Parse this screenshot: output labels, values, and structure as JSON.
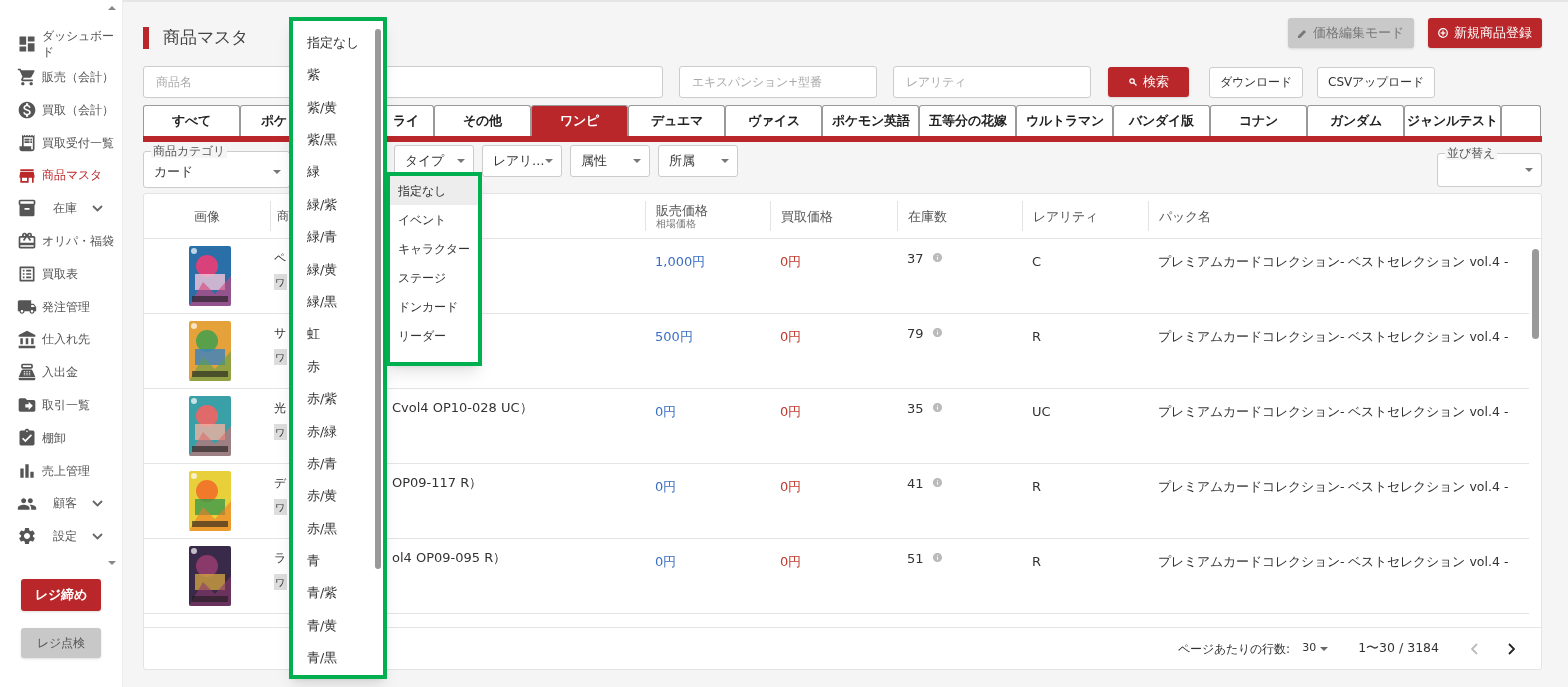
{
  "sidebar": {
    "items": [
      {
        "label": "ダッシュボード",
        "selected": false,
        "expandable": false
      },
      {
        "label": "販売（会計）",
        "selected": false,
        "expandable": false
      },
      {
        "label": "買取（会計）",
        "selected": false,
        "expandable": false
      },
      {
        "label": "買取受付一覧",
        "selected": false,
        "expandable": false
      },
      {
        "label": "商品マスタ",
        "selected": true,
        "expandable": false
      },
      {
        "label": "在庫",
        "selected": false,
        "expandable": true
      },
      {
        "label": "オリパ・福袋",
        "selected": false,
        "expandable": false
      },
      {
        "label": "買取表",
        "selected": false,
        "expandable": false
      },
      {
        "label": "発注管理",
        "selected": false,
        "expandable": false
      },
      {
        "label": "仕入れ先",
        "selected": false,
        "expandable": false
      },
      {
        "label": "入出金",
        "selected": false,
        "expandable": false
      },
      {
        "label": "取引一覧",
        "selected": false,
        "expandable": false
      },
      {
        "label": "棚卸",
        "selected": false,
        "expandable": false
      },
      {
        "label": "売上管理",
        "selected": false,
        "expandable": false
      },
      {
        "label": "顧客",
        "selected": false,
        "expandable": true
      },
      {
        "label": "設定",
        "selected": false,
        "expandable": true
      }
    ],
    "buttons": [
      {
        "label": "レジ締め",
        "kind": "primary"
      },
      {
        "label": "レジ点検",
        "kind": "secondary"
      }
    ]
  },
  "header": {
    "title": "商品マスタ",
    "buttons": [
      {
        "label": "価格編集モード",
        "kind": "edit",
        "disabled": true
      },
      {
        "label": "新規商品登録",
        "kind": "add",
        "disabled": false
      }
    ]
  },
  "search": {
    "fields": [
      {
        "placeholder": "商品名"
      },
      {
        "placeholder": "エキスパンション+型番"
      },
      {
        "placeholder": "レアリティ"
      }
    ],
    "search_button": "検索",
    "buttons": [
      "ダウンロード",
      "CSVアップロード"
    ]
  },
  "tabs": [
    {
      "label": "すべて",
      "selected": false
    },
    {
      "label": "ポケ",
      "selected": false
    },
    {
      "label": "ライ",
      "selected": false
    },
    {
      "label": "その他",
      "selected": false
    },
    {
      "label": "ワンピ",
      "selected": true
    },
    {
      "label": "デュエマ",
      "selected": false
    },
    {
      "label": "ヴァイス",
      "selected": false
    },
    {
      "label": "ポケモン英語",
      "selected": false
    },
    {
      "label": "五等分の花嫁",
      "selected": false
    },
    {
      "label": "ウルトラマン",
      "selected": false
    },
    {
      "label": "バンダイ版",
      "selected": false
    },
    {
      "label": "コナン",
      "selected": false
    },
    {
      "label": "ガンダム",
      "selected": false
    },
    {
      "label": "ジャンルテスト",
      "selected": false
    }
  ],
  "filters": {
    "category": {
      "label": "商品カテゴリ",
      "value": "カード"
    },
    "selects": [
      "タイプ",
      "レアリ…",
      "属性",
      "所属"
    ],
    "sort": {
      "label": "並び替え"
    }
  },
  "table": {
    "columns": [
      {
        "label": "画像"
      },
      {
        "label": "商"
      },
      {
        "label": "販売価格",
        "sublabel": "相場価格"
      },
      {
        "label": "買取価格"
      },
      {
        "label": "在庫数"
      },
      {
        "label": "レアリティ"
      },
      {
        "label": "パック名"
      }
    ],
    "rows": [
      {
        "name_start": "ペ",
        "tag": "ワ",
        "sale_price": "1,000円",
        "buy_price": "0円",
        "stock": "37",
        "rarity": "C",
        "pack": "プレミアムカードコレクション- ベストセレクション vol.4 -"
      },
      {
        "name_start": "サ",
        "tag": "ワ",
        "sale_price": "500円",
        "buy_price": "0円",
        "stock": "79",
        "rarity": "R",
        "pack": "プレミアムカードコレクション- ベストセレクション vol.4 -"
      },
      {
        "name_start": "光",
        "name_end": "Cvol4 OP10-028 UC）",
        "tag": "ワ",
        "sale_price": "0円",
        "buy_price": "0円",
        "stock": "35",
        "rarity": "UC",
        "pack": "プレミアムカードコレクション- ベストセレクション vol.4 -"
      },
      {
        "name_start": "デ",
        "name_end": "OP09-117 R）",
        "tag": "ワ",
        "sale_price": "0円",
        "buy_price": "0円",
        "stock": "41",
        "rarity": "R",
        "pack": "プレミアムカードコレクション- ベストセレクション vol.4 -"
      },
      {
        "name_start": "ラ",
        "name_end": "ol4 OP09-095 R）",
        "tag": "ワ",
        "sale_price": "0円",
        "buy_price": "0円",
        "stock": "51",
        "rarity": "R",
        "pack": "プレミアムカードコレクション- ベストセレクション vol.4 -"
      }
    ]
  },
  "pagination": {
    "rows_per_page_label": "ページあたりの行数:",
    "rows_per_page": "30",
    "range": "1〜30 / 3184"
  },
  "color_menu": {
    "items": [
      {
        "label": "指定なし",
        "selected": false
      },
      {
        "label": "紫",
        "selected": false
      },
      {
        "label": "紫/黄",
        "selected": false
      },
      {
        "label": "紫/黒",
        "selected": false
      },
      {
        "label": "緑",
        "selected": false
      },
      {
        "label": "緑/紫",
        "selected": false
      },
      {
        "label": "緑/青",
        "selected": false
      },
      {
        "label": "緑/黄",
        "selected": false
      },
      {
        "label": "緑/黒",
        "selected": false
      },
      {
        "label": "虹",
        "selected": false
      },
      {
        "label": "赤",
        "selected": false
      },
      {
        "label": "赤/紫",
        "selected": false
      },
      {
        "label": "赤/緑",
        "selected": false
      },
      {
        "label": "赤/青",
        "selected": false
      },
      {
        "label": "赤/黄",
        "selected": false
      },
      {
        "label": "赤/黒",
        "selected": false
      },
      {
        "label": "青",
        "selected": false
      },
      {
        "label": "青/紫",
        "selected": false
      },
      {
        "label": "青/黄",
        "selected": false
      },
      {
        "label": "青/黒",
        "selected": false
      }
    ]
  },
  "type_menu": {
    "items": [
      {
        "label": "指定なし",
        "selected": true
      },
      {
        "label": "イベント",
        "selected": false
      },
      {
        "label": "キャラクター",
        "selected": false
      },
      {
        "label": "ステージ",
        "selected": false
      },
      {
        "label": "ドンカード",
        "selected": false
      },
      {
        "label": "リーダー",
        "selected": false
      }
    ]
  }
}
